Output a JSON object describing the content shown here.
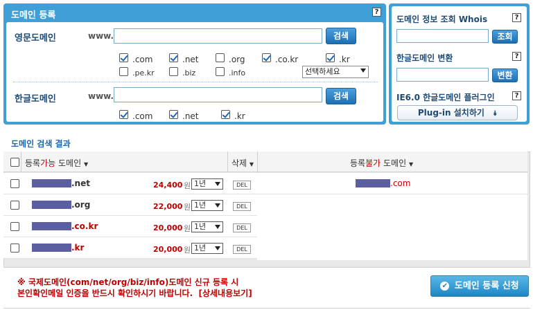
{
  "register": {
    "title": "도메인 등록",
    "help": "?",
    "english": {
      "label": "영문도메인",
      "prefix": "www.",
      "search_label": "검색",
      "tlds": [
        {
          "name": ".com",
          "checked": true
        },
        {
          "name": ".net",
          "checked": true
        },
        {
          "name": ".org",
          "checked": false
        },
        {
          "name": ".co.kr",
          "checked": true
        },
        {
          "name": ".kr",
          "checked": true
        },
        {
          "name": ".pe.kr",
          "checked": false
        },
        {
          "name": ".biz",
          "checked": false
        },
        {
          "name": ".info",
          "checked": false
        }
      ],
      "more_select": "선택하세요"
    },
    "korean": {
      "label": "한글도메인",
      "prefix": "www.",
      "search_label": "검색",
      "tlds": [
        {
          "name": ".com",
          "checked": true
        },
        {
          "name": ".net",
          "checked": true
        },
        {
          "name": ".kr",
          "checked": true
        }
      ]
    }
  },
  "whois": {
    "title": "도메인 정보 조회 Whois",
    "help": "?",
    "lookup_label": "조회",
    "convert_title": "한글도메인 변환",
    "convert_help": "?",
    "convert_label": "변환",
    "plugin_title": "IE6.0 한글도메인 플러그인",
    "plugin_help": "?",
    "plugin_button": "Plug-in 설치하기",
    "plugin_icon": "double-chevron-down-icon"
  },
  "results": {
    "title": "도메인 검색 결과",
    "headers": {
      "available_pre": "등록",
      "available_em": "가능",
      "available_post": " 도메인",
      "delete": "삭제",
      "unavailable_pre": "등록",
      "unavailable_em": "불가",
      "unavailable_post": " 도메인"
    },
    "available": [
      {
        "tld": ".net",
        "price": "24,400",
        "unit": "원",
        "period": "1년",
        "del": "DEL",
        "color": "#333333"
      },
      {
        "tld": ".org",
        "price": "22,000",
        "unit": "원",
        "period": "1년",
        "del": "DEL",
        "color": "#333333"
      },
      {
        "tld": ".co.kr",
        "price": "20,000",
        "unit": "원",
        "period": "1년",
        "del": "DEL",
        "color": "#c00000"
      },
      {
        "tld": ".kr",
        "price": "20,000",
        "unit": "원",
        "period": "1년",
        "del": "DEL",
        "color": "#c00000"
      }
    ],
    "unavailable": [
      {
        "tld": ".com"
      }
    ]
  },
  "notice": {
    "line1": "※ 국제도메인(com/net/org/biz/info)도메인 신규 등록 시",
    "line2": "본인확인메일 인증을 반드시 확인하시기 바랍니다.",
    "link": "[상세내용보기]"
  },
  "apply_button": "도메인 등록 신청",
  "colors": {
    "accent": "#3f9fd6",
    "price": "#c00000",
    "masked": "#5b5ea0"
  }
}
